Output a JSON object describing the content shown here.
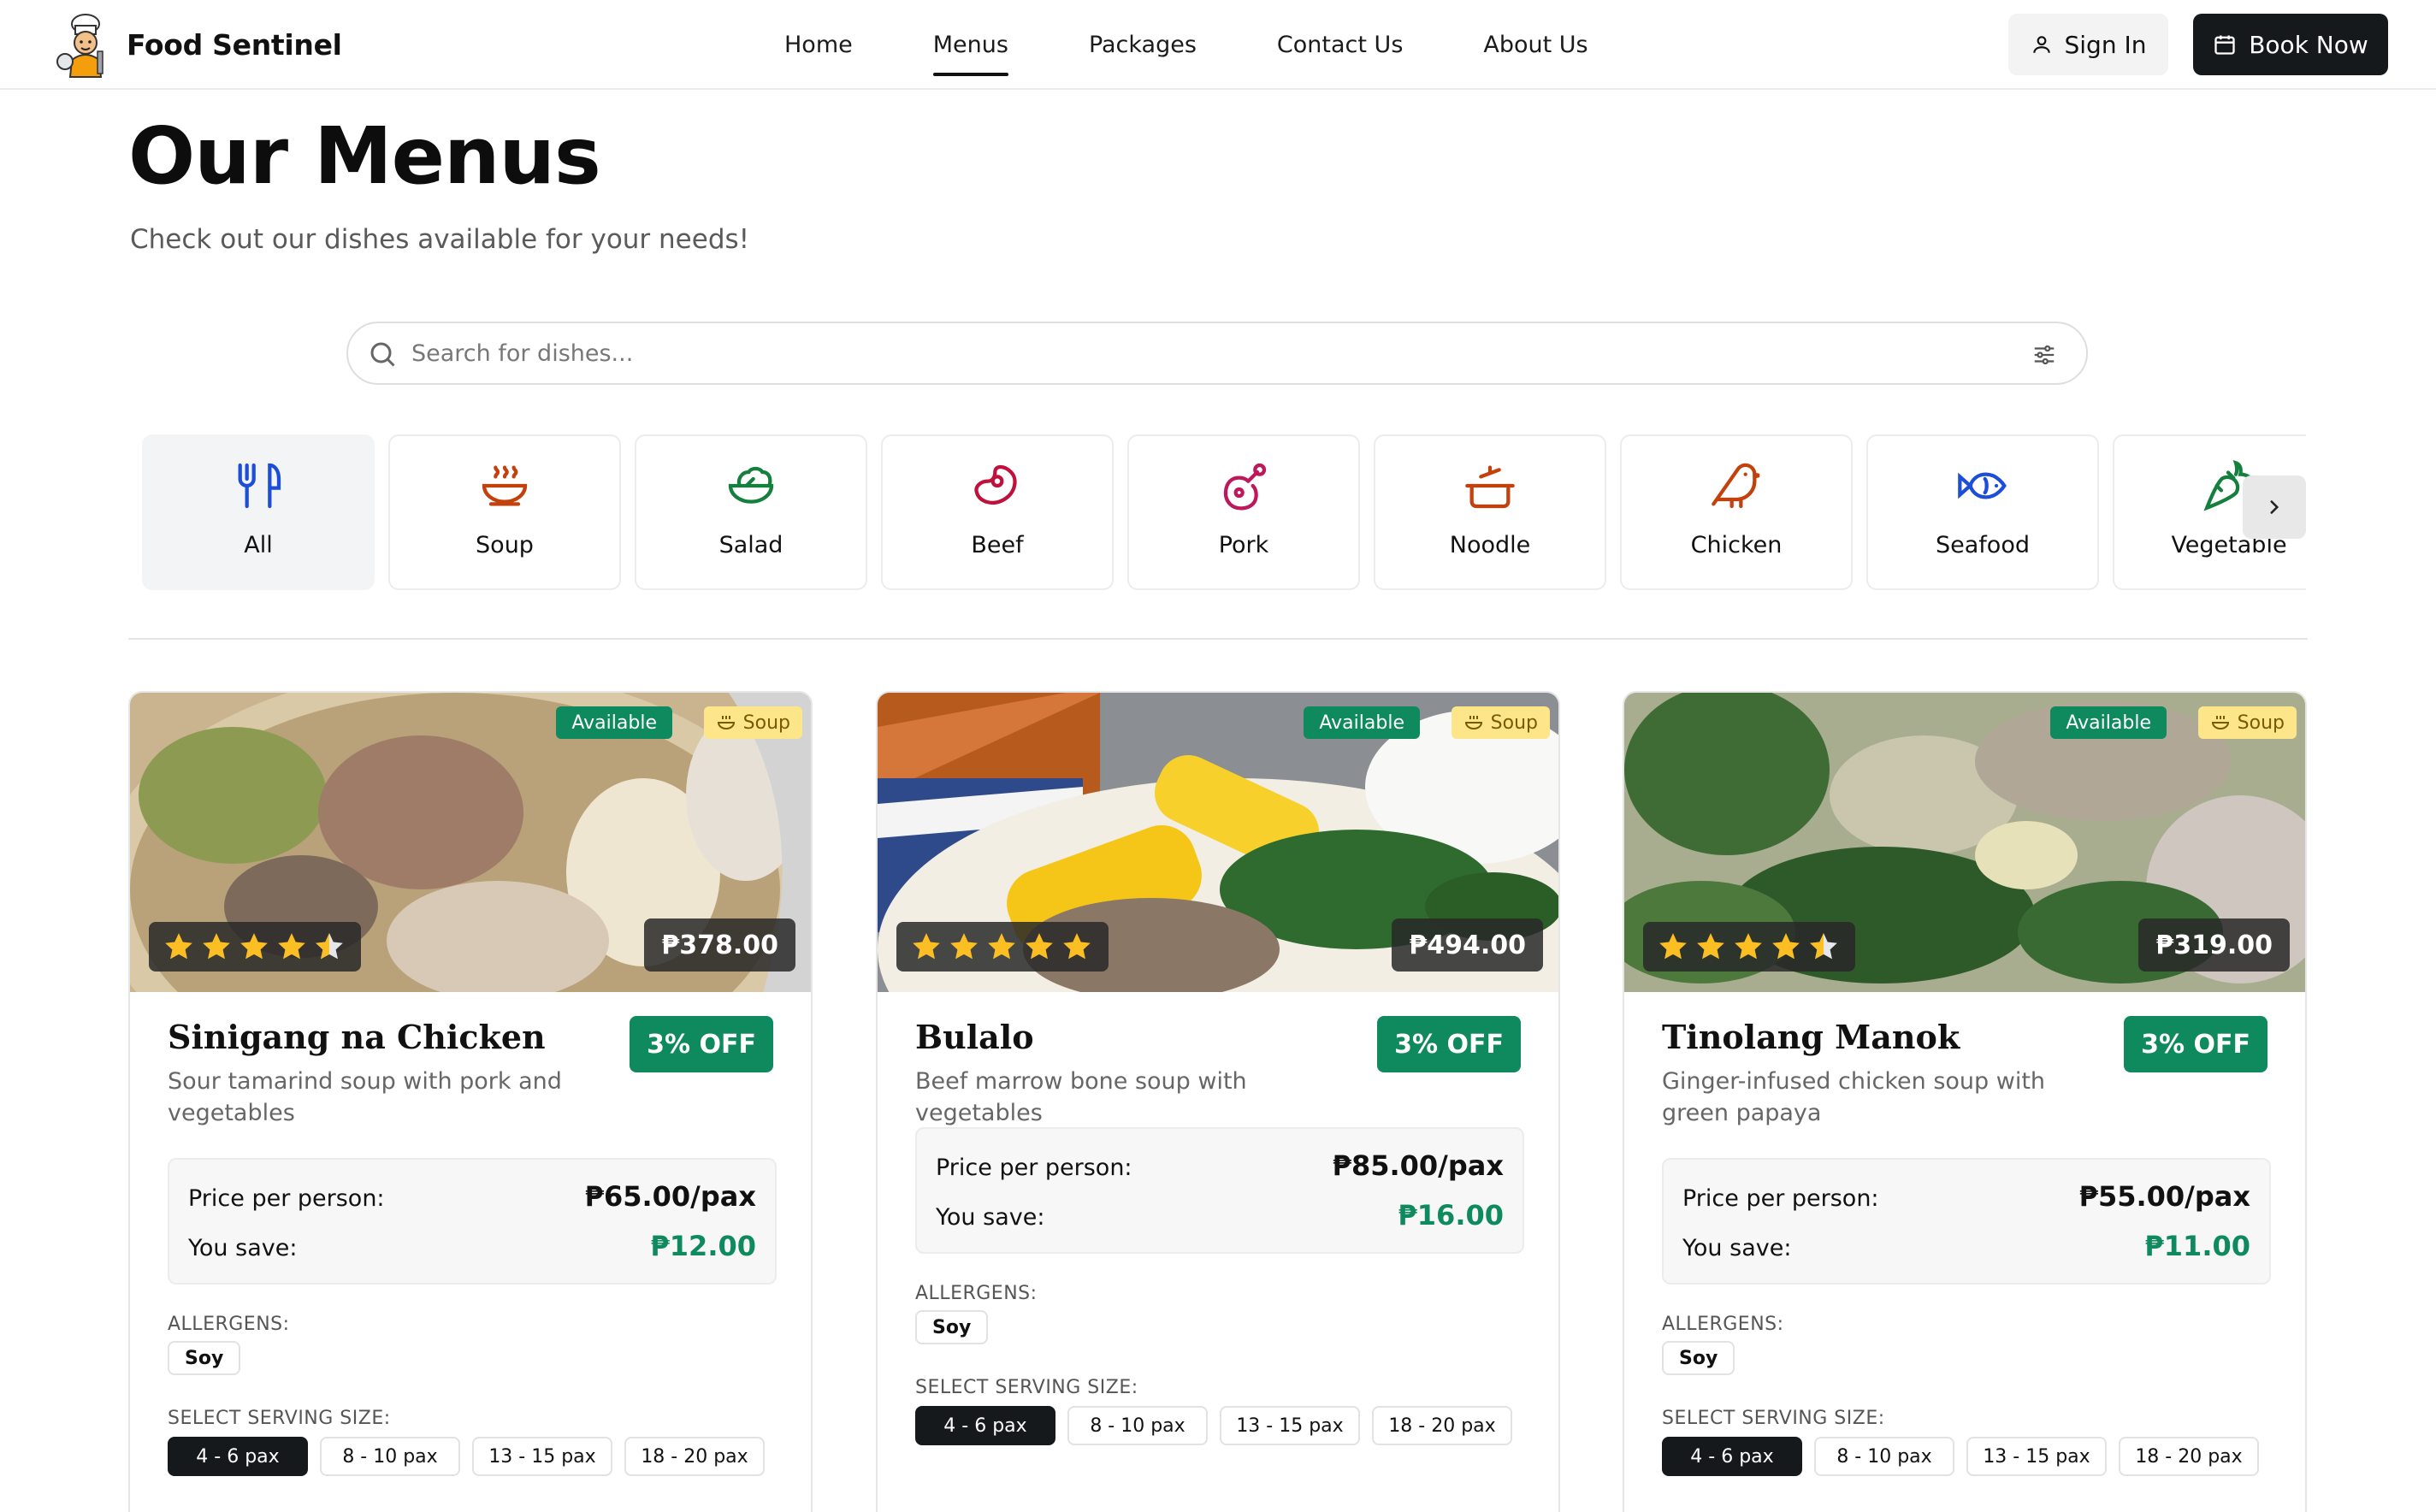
{
  "brand": {
    "name": "Food Sentinel"
  },
  "nav": {
    "items": [
      "Home",
      "Menus",
      "Packages",
      "Contact Us",
      "About Us"
    ],
    "active": "Menus"
  },
  "actions": {
    "sign_in": "Sign In",
    "book_now": "Book Now"
  },
  "hero": {
    "title": "Our Menus",
    "subtitle": "Check out our dishes available for your needs!"
  },
  "search": {
    "placeholder": "Search for dishes..."
  },
  "categories": [
    {
      "label": "All",
      "icon": "utensils-icon",
      "color": "#1d4ed8"
    },
    {
      "label": "Soup",
      "icon": "soup-bowl-icon",
      "color": "#c2410c"
    },
    {
      "label": "Salad",
      "icon": "salad-icon",
      "color": "#15803d"
    },
    {
      "label": "Beef",
      "icon": "beef-icon",
      "color": "#be123c"
    },
    {
      "label": "Pork",
      "icon": "ham-icon",
      "color": "#be185d"
    },
    {
      "label": "Noodle",
      "icon": "cooking-pot-icon",
      "color": "#c2410c"
    },
    {
      "label": "Chicken",
      "icon": "bird-icon",
      "color": "#c2410c"
    },
    {
      "label": "Seafood",
      "icon": "fish-icon",
      "color": "#1d4ed8"
    },
    {
      "label": "Vegetable",
      "icon": "carrot-icon",
      "color": "#15803d"
    }
  ],
  "cards": [
    {
      "name": "Sinigang na Chicken",
      "description": "Sour tamarind soup with pork and vegetables",
      "status": "Available",
      "category": "Soup",
      "rating": 4.5,
      "total_price": "₱378.00",
      "discount": "3% OFF",
      "price_label": "Price per person:",
      "price_per_person": "₱65.00/pax",
      "save_label": "You save:",
      "savings": "₱12.00",
      "allergens_label": "ALLERGENS:",
      "allergens": [
        "Soy"
      ],
      "serving_label": "SELECT SERVING SIZE:",
      "serving_sizes": [
        "4 - 6 pax",
        "8 - 10 pax",
        "13 - 15 pax",
        "18 - 20 pax"
      ],
      "selected_size": "4 - 6 pax"
    },
    {
      "name": "Bulalo",
      "description": "Beef marrow bone soup with vegetables",
      "status": "Available",
      "category": "Soup",
      "rating": 5,
      "total_price": "₱494.00",
      "discount": "3% OFF",
      "price_label": "Price per person:",
      "price_per_person": "₱85.00/pax",
      "save_label": "You save:",
      "savings": "₱16.00",
      "allergens_label": "ALLERGENS:",
      "allergens": [
        "Soy"
      ],
      "serving_label": "SELECT SERVING SIZE:",
      "serving_sizes": [
        "4 - 6 pax",
        "8 - 10 pax",
        "13 - 15 pax",
        "18 - 20 pax"
      ],
      "selected_size": "4 - 6 pax"
    },
    {
      "name": "Tinolang Manok",
      "description": "Ginger-infused chicken soup with green papaya",
      "status": "Available",
      "category": "Soup",
      "rating": 4.5,
      "total_price": "₱319.00",
      "discount": "3% OFF",
      "price_label": "Price per person:",
      "price_per_person": "₱55.00/pax",
      "save_label": "You save:",
      "savings": "₱11.00",
      "allergens_label": "ALLERGENS:",
      "allergens": [
        "Soy"
      ],
      "serving_label": "SELECT SERVING SIZE:",
      "serving_sizes": [
        "4 - 6 pax",
        "8 - 10 pax",
        "13 - 15 pax",
        "18 - 20 pax"
      ],
      "selected_size": "4 - 6 pax"
    }
  ],
  "colors": {
    "accent_green": "#0f8a5f",
    "dark": "#16191c",
    "category_badge": "#fde68a"
  }
}
